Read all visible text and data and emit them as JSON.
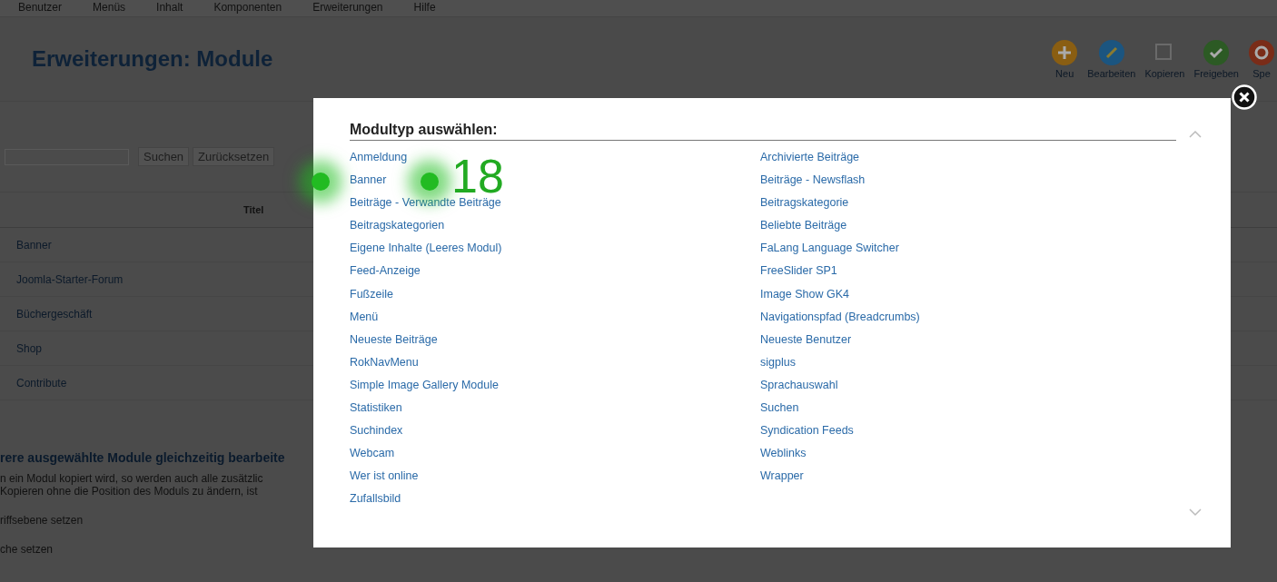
{
  "top_menu": [
    "Benutzer",
    "Menüs",
    "Inhalt",
    "Komponenten",
    "Erweiterungen",
    "Hilfe"
  ],
  "page_title": "Erweiterungen: Module",
  "toolbar": [
    {
      "kind": "add",
      "label": "Neu"
    },
    {
      "kind": "edit",
      "label": "Bearbeiten"
    },
    {
      "kind": "copy",
      "label": "Kopieren"
    },
    {
      "kind": "publish",
      "label": "Freigeben"
    },
    {
      "kind": "unpublish",
      "label": "Spe"
    }
  ],
  "filter": {
    "buttons": [
      "Suchen",
      "Zurücksetzen"
    ]
  },
  "table": {
    "columns": [
      "Titel"
    ],
    "rows": [
      "Banner",
      "Joomla-Starter-Forum",
      "Büchergeschäft",
      "Shop",
      "Contribute"
    ]
  },
  "batch": {
    "heading": "rere ausgewählte Module gleichzeitig bearbeite",
    "lines": [
      "n ein Modul kopiert wird, so werden auch alle zusätzlic",
      "Kopieren ohne die Position des Moduls zu ändern, ist"
    ],
    "options": [
      "riffsebene setzen",
      "che setzen"
    ]
  },
  "modal": {
    "title": "Modultyp auswählen:",
    "columns": [
      [
        "Anmeldung",
        "Banner",
        "Beiträge - Verwandte Beiträge",
        "Beitragskategorien",
        "Eigene Inhalte (Leeres Modul)",
        "Feed-Anzeige",
        "Fußzeile",
        "Menü",
        "Neueste Beiträge",
        "RokNavMenu",
        "Simple Image Gallery Module",
        "Statistiken",
        "Suchindex",
        "Webcam",
        "Wer ist online",
        "Zufallsbild"
      ],
      [
        "Archivierte Beiträge",
        "Beiträge - Newsflash",
        "Beitragskategorie",
        "Beliebte Beiträge",
        "FaLang Language Switcher",
        "FreeSlider SP1",
        "Image Show GK4",
        "Navigationspfad (Breadcrumbs)",
        "Neueste Benutzer",
        "sigplus",
        "Sprachauswahl",
        "Suchen",
        "Syndication Feeds",
        "Weblinks",
        "Wrapper"
      ]
    ]
  },
  "annotation": {
    "label": "18"
  }
}
